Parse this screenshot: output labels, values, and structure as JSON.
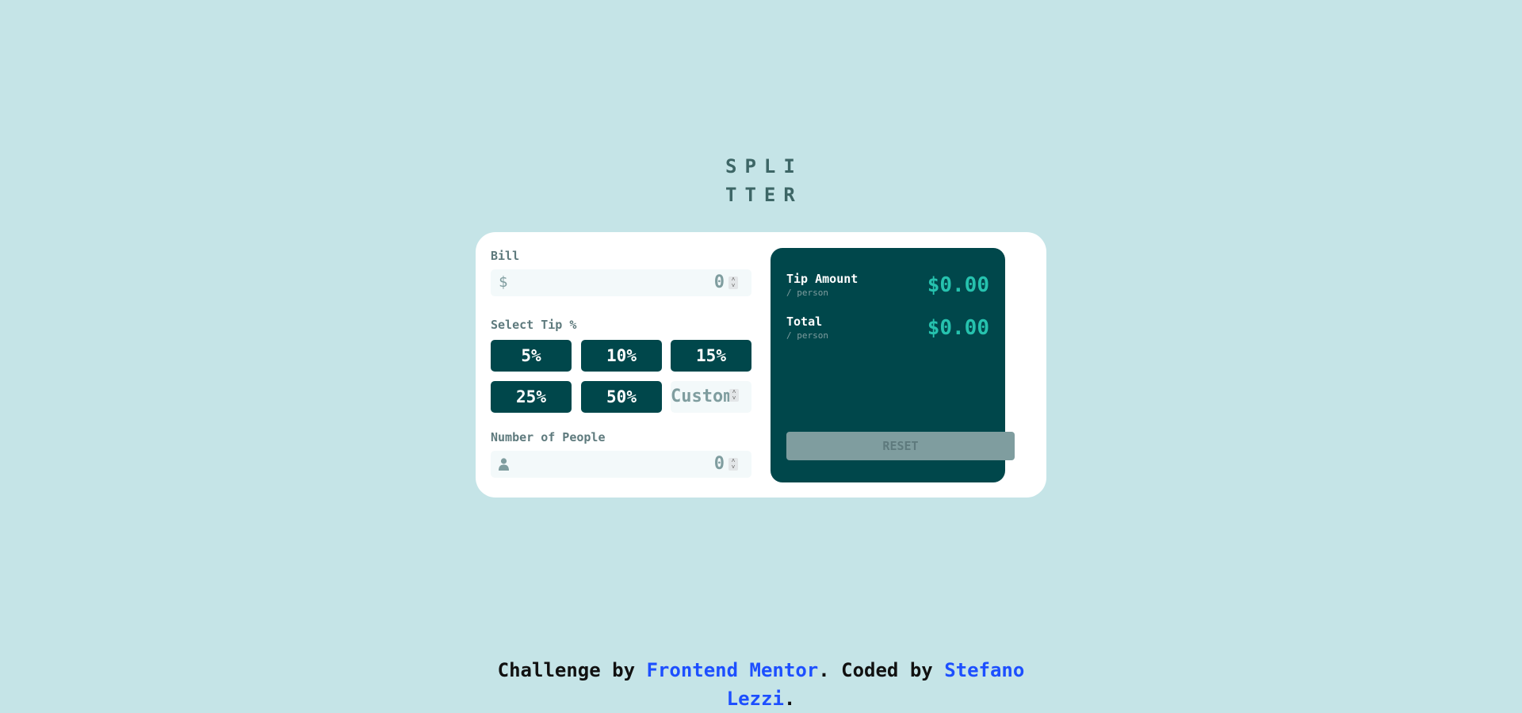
{
  "logo": {
    "line1": "SPLI",
    "line2": "TTER"
  },
  "bill": {
    "label": "Bill",
    "prefix": "$",
    "value": "0"
  },
  "tip": {
    "label": "Select Tip %",
    "options": [
      "5%",
      "10%",
      "15%",
      "25%",
      "50%"
    ],
    "custom_placeholder": "Custom"
  },
  "people": {
    "label": "Number of People",
    "value": "0",
    "icon": "person-icon"
  },
  "results": {
    "tip_label": "Tip Amount",
    "tip_sub": "/ person",
    "tip_value": "$0.00",
    "total_label": "Total",
    "total_sub": "/ person",
    "total_value": "$0.00",
    "reset_label": "RESET"
  },
  "footer": {
    "prefix": "Challenge by ",
    "link1": "Frontend Mentor",
    "middle": ". Coded by ",
    "link2": "Stefano Lezzi",
    "suffix": "."
  },
  "colors": {
    "background": "#c5e4e7",
    "dark_cyan": "#00474b",
    "accent": "#26c2ae",
    "link": "#1d4fff"
  }
}
